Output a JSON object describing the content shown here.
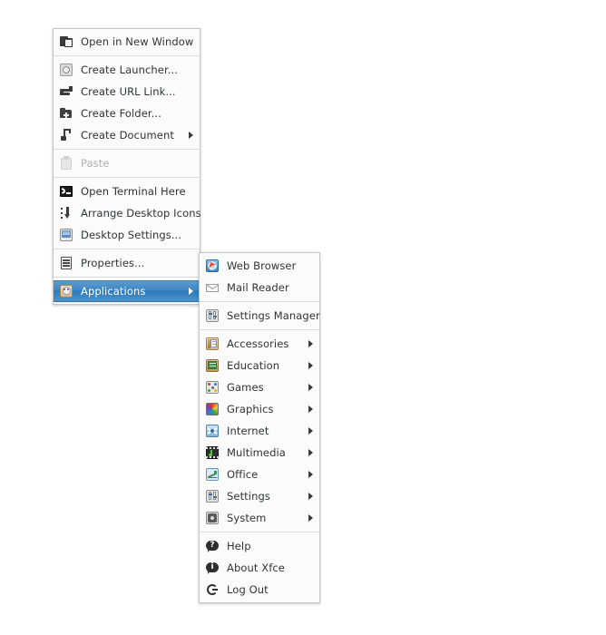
{
  "colors": {
    "menu_bg": "#fbfbfb",
    "menu_border": "#c6c6c6",
    "text": "#2e3436",
    "disabled_text": "#b0b0b0",
    "highlight_bg": "#3d85c6",
    "highlight_text": "#ffffff",
    "separator": "#dcdcdc",
    "desktop_bg": "#ffffff"
  },
  "desktop_menu": {
    "name": "desktop-context-menu",
    "items": [
      {
        "label": "Open in New Window",
        "icon": "open-in-new-window-icon",
        "type": "item",
        "state": "normal",
        "submenu": false
      },
      {
        "type": "separator"
      },
      {
        "label": "Create Launcher...",
        "icon": "create-launcher-icon",
        "type": "item",
        "state": "normal",
        "submenu": false
      },
      {
        "label": "Create URL Link...",
        "icon": "create-url-link-icon",
        "type": "item",
        "state": "normal",
        "submenu": false
      },
      {
        "label": "Create Folder...",
        "icon": "create-folder-icon",
        "type": "item",
        "state": "normal",
        "submenu": false
      },
      {
        "label": "Create Document",
        "icon": "create-document-icon",
        "type": "item",
        "state": "normal",
        "submenu": true
      },
      {
        "type": "separator"
      },
      {
        "label": "Paste",
        "icon": "paste-icon",
        "type": "item",
        "state": "disabled",
        "submenu": false
      },
      {
        "type": "separator"
      },
      {
        "label": "Open Terminal Here",
        "icon": "terminal-icon",
        "type": "item",
        "state": "normal",
        "submenu": false
      },
      {
        "label": "Arrange Desktop Icons",
        "icon": "arrange-desktop-icons-icon",
        "type": "item",
        "state": "normal",
        "submenu": false
      },
      {
        "label": "Desktop Settings...",
        "icon": "desktop-settings-icon",
        "type": "item",
        "state": "normal",
        "submenu": false
      },
      {
        "type": "separator"
      },
      {
        "label": "Properties...",
        "icon": "properties-icon",
        "type": "item",
        "state": "normal",
        "submenu": false
      },
      {
        "type": "separator"
      },
      {
        "label": "Applications",
        "icon": "applications-icon",
        "type": "item",
        "state": "selected",
        "submenu": true
      }
    ]
  },
  "applications_submenu": {
    "name": "applications-submenu",
    "items": [
      {
        "label": "Web Browser",
        "icon": "web-browser-icon",
        "type": "item",
        "state": "normal",
        "submenu": false
      },
      {
        "label": "Mail Reader",
        "icon": "mail-reader-icon",
        "type": "item",
        "state": "normal",
        "submenu": false
      },
      {
        "type": "separator"
      },
      {
        "label": "Settings Manager",
        "icon": "settings-manager-icon",
        "type": "item",
        "state": "normal",
        "submenu": false
      },
      {
        "type": "separator"
      },
      {
        "label": "Accessories",
        "icon": "accessories-icon",
        "type": "item",
        "state": "normal",
        "submenu": true
      },
      {
        "label": "Education",
        "icon": "education-icon",
        "type": "item",
        "state": "normal",
        "submenu": true
      },
      {
        "label": "Games",
        "icon": "games-icon",
        "type": "item",
        "state": "normal",
        "submenu": true
      },
      {
        "label": "Graphics",
        "icon": "graphics-icon",
        "type": "item",
        "state": "normal",
        "submenu": true
      },
      {
        "label": "Internet",
        "icon": "internet-icon",
        "type": "item",
        "state": "normal",
        "submenu": true
      },
      {
        "label": "Multimedia",
        "icon": "multimedia-icon",
        "type": "item",
        "state": "normal",
        "submenu": true
      },
      {
        "label": "Office",
        "icon": "office-icon",
        "type": "item",
        "state": "normal",
        "submenu": true
      },
      {
        "label": "Settings",
        "icon": "settings-icon",
        "type": "item",
        "state": "normal",
        "submenu": true
      },
      {
        "label": "System",
        "icon": "system-icon",
        "type": "item",
        "state": "normal",
        "submenu": true
      },
      {
        "type": "separator"
      },
      {
        "label": "Help",
        "icon": "help-icon",
        "type": "item",
        "state": "normal",
        "submenu": false
      },
      {
        "label": "About Xfce",
        "icon": "about-icon",
        "type": "item",
        "state": "normal",
        "submenu": false
      },
      {
        "label": "Log Out",
        "icon": "log-out-icon",
        "type": "item",
        "state": "normal",
        "submenu": false
      }
    ]
  }
}
